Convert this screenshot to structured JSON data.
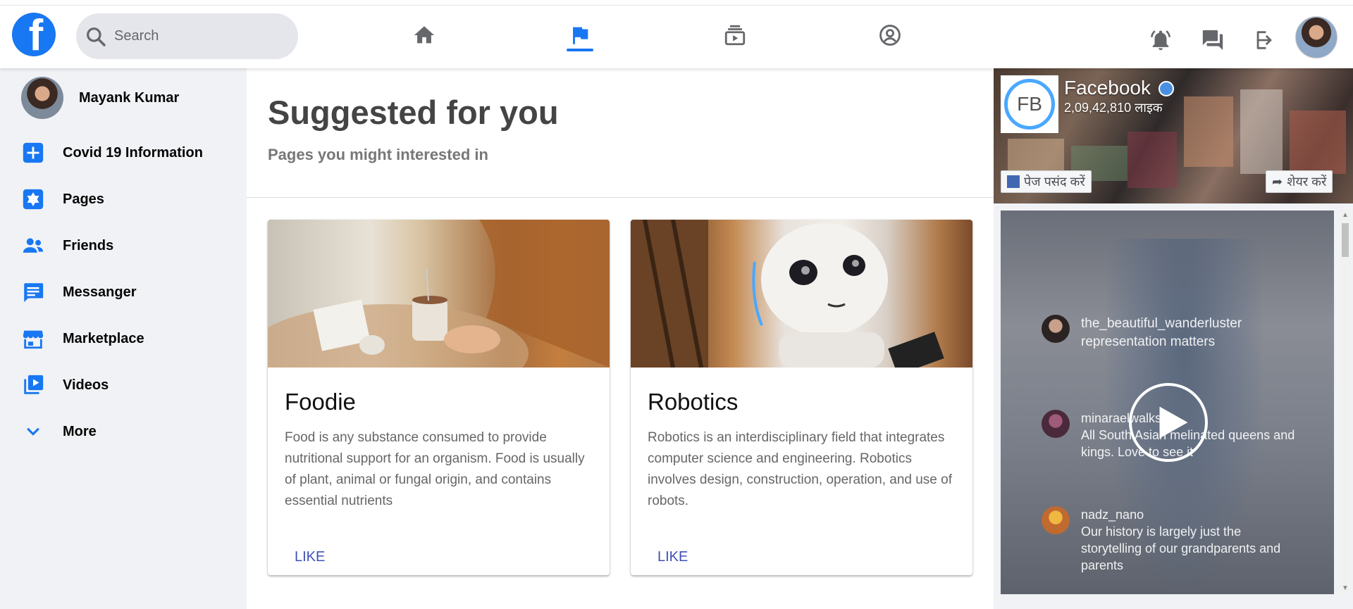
{
  "header": {
    "logo_letter": "f",
    "search": {
      "placeholder": "Search"
    },
    "nav": [
      {
        "name": "home-icon"
      },
      {
        "name": "pages-flag-icon",
        "active": true
      },
      {
        "name": "watch-icon"
      },
      {
        "name": "profile-circle-icon"
      }
    ],
    "right_icons": [
      "notification-bell-icon",
      "messages-icon",
      "logout-icon",
      "avatar"
    ],
    "accent_color": "#1877f2"
  },
  "sidebar": {
    "profile_name": "Mayank Kumar",
    "items": [
      {
        "label": "Covid 19 Information",
        "icon": "covid-plus-icon"
      },
      {
        "label": "Pages",
        "icon": "pages-icon"
      },
      {
        "label": "Friends",
        "icon": "friends-icon"
      },
      {
        "label": "Messanger",
        "icon": "messenger-icon"
      },
      {
        "label": "Marketplace",
        "icon": "marketplace-icon"
      },
      {
        "label": "Videos",
        "icon": "videos-icon"
      },
      {
        "label": "More",
        "icon": "chevron-down-icon"
      }
    ]
  },
  "main": {
    "title": "Suggested for you",
    "subtitle": "Pages you might interested in",
    "cards": [
      {
        "title": "Foodie",
        "text": "Food is any substance consumed to provide nutritional support for an organism. Food is usually of plant, animal or fungal origin, and contains essential nutrients",
        "action": "LIKE"
      },
      {
        "title": "Robotics",
        "text": "Robotics is an interdisciplinary field that integrates computer science and engineering. Robotics involves design, construction, operation, and use of robots.",
        "action": "LIKE"
      }
    ]
  },
  "right_panel": {
    "page_name": "Facebook",
    "page_logo_text": "FB",
    "page_likes": "2,09,42,810 लाइक",
    "like_button": "पेज पसंद करें",
    "share_button": "शेयर करें",
    "comments": [
      {
        "user": "the_beautiful_wanderluster",
        "text": "representation matters"
      },
      {
        "user": "minaraelwalks",
        "text": "All South Asian melinated queens and kings. Love to see it"
      },
      {
        "user": "nadz_nano",
        "text": "Our history is largely just the storytelling of our grandparents and parents"
      }
    ]
  }
}
